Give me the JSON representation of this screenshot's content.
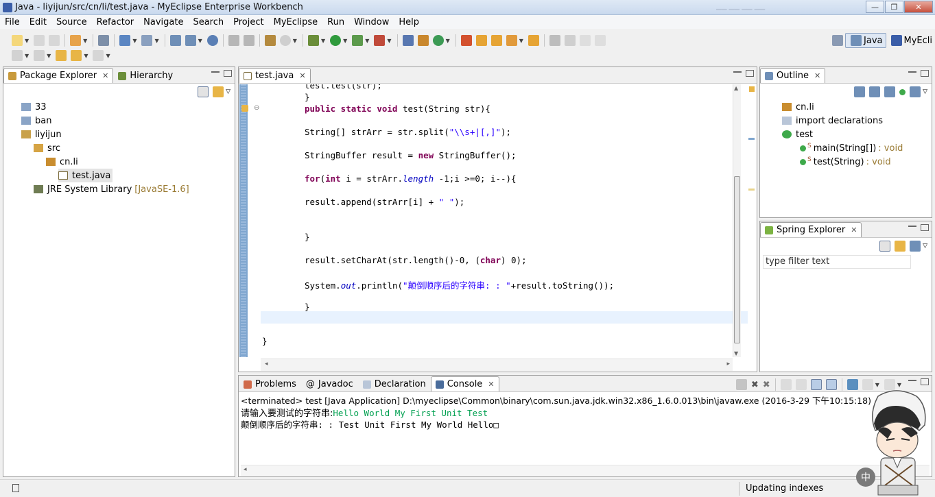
{
  "window": {
    "title": "Java - liyijun/src/cn/li/test.java - MyEclipse Enterprise Workbench",
    "min": "—",
    "max": "❐",
    "close": "✕"
  },
  "menu": [
    "File",
    "Edit",
    "Source",
    "Refactor",
    "Navigate",
    "Search",
    "Project",
    "MyEclipse",
    "Run",
    "Window",
    "Help"
  ],
  "perspectives": {
    "java": "Java",
    "myeclipse": "MyEcli"
  },
  "package_explorer": {
    "tabs": [
      "Package Explorer",
      "Hierarchy"
    ],
    "items": [
      {
        "label": "33"
      },
      {
        "label": "ban"
      },
      {
        "label": "liyijun"
      },
      {
        "label": "src"
      },
      {
        "label": "cn.li"
      },
      {
        "label": "test.java"
      },
      {
        "label": "JRE System Library",
        "decoration": "[JavaSE-1.6]"
      }
    ]
  },
  "editor": {
    "tab": "test.java",
    "lines": {
      "l0": "test.test(str);",
      "l1": "}",
      "l2a": "public static void ",
      "l2b": "test(String str){",
      "l3": "String[] strArr = str.split(",
      "l3s": "\"\\\\s+|[,]\"",
      "l3e": ");",
      "l4a": "StringBuffer result = ",
      "l4k": "new",
      "l4b": " StringBuffer();",
      "l5k": "for",
      "l5a": "(",
      "l5k2": "int",
      "l5b": " i = strArr.",
      "l5f": "length",
      "l5c": " -1;i >=0; i--){",
      "l6a": "result.append(strArr[i] + ",
      "l6s": "\" \"",
      "l6b": ");",
      "l7": "}",
      "l8a": "result.setCharAt(str.length()-0, (",
      "l8k": "char",
      "l8b": ") 0);",
      "l9a": "System.",
      "l9f": "out",
      "l9b": ".println(",
      "l9s": "\"颠倒顺序后的字符串: : \"",
      "l9c": "+result.toString());",
      "l10": "}",
      "l11": "}"
    }
  },
  "outline": {
    "tab": "Outline",
    "items": [
      {
        "label": "cn.li"
      },
      {
        "label": "import declarations"
      },
      {
        "label": "test"
      },
      {
        "label": "main(String[])",
        "sig": ": void",
        "mod": "S"
      },
      {
        "label": "test(String)",
        "sig": ": void",
        "mod": "S"
      }
    ]
  },
  "spring_explorer": {
    "tab": "Spring Explorer",
    "filter_placeholder": "type filter text"
  },
  "bottom": {
    "tabs": [
      "Problems",
      "Javadoc",
      "Declaration",
      "Console"
    ],
    "console_header": "<terminated> test [Java Application] D:\\myeclipse\\Common\\binary\\com.sun.java.jdk.win32.x86_1.6.0.013\\bin\\javaw.exe (2016-3-29 下午10:15:18)",
    "prompt": "请输入要测试的字符串:",
    "input": "Hello World My First Unit Test",
    "output": "颠倒顺序后的字符串: : Test Unit First My World Hello□"
  },
  "status": {
    "text": "Updating indexes"
  },
  "ime": "中",
  "colors": {
    "keyword": "#7f0055",
    "string": "#2a00ff",
    "field": "#0000c0",
    "console_input": "#00a050",
    "decoration": "#9a7b34"
  }
}
